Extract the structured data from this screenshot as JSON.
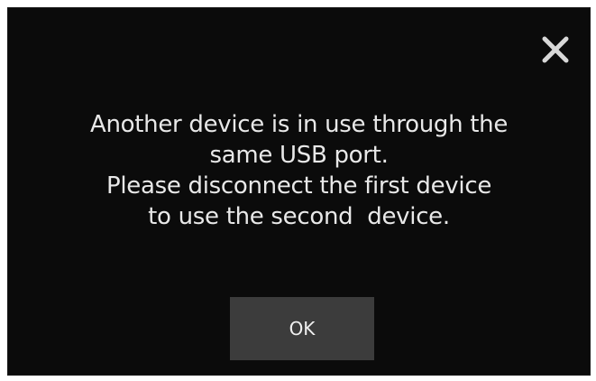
{
  "dialog": {
    "message_lines": [
      "Another device is in use through the",
      "same USB port.",
      "Please disconnect the first device",
      "to use the second  device."
    ],
    "ok_label": "OK",
    "close_icon": "close-icon"
  },
  "colors": {
    "background": "#0b0b0b",
    "text": "#e8e8e8",
    "button": "#3c3c3c",
    "close_icon": "#d8d8d8"
  }
}
